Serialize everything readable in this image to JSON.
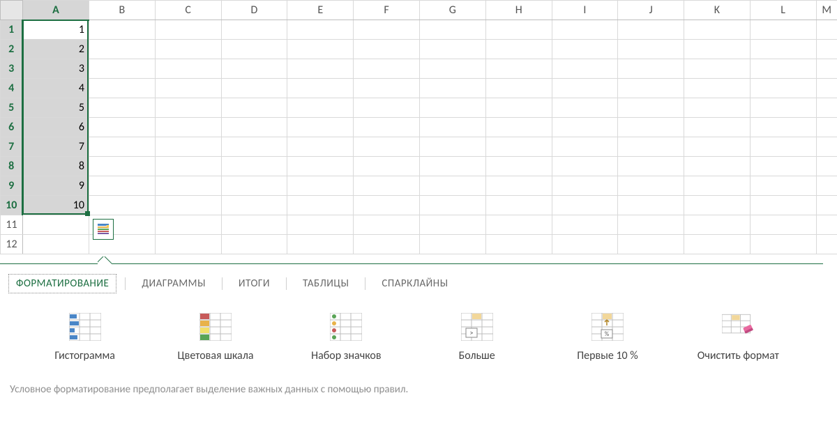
{
  "columns": [
    "A",
    "B",
    "C",
    "D",
    "E",
    "F",
    "G",
    "H",
    "I",
    "J",
    "K",
    "L",
    "M"
  ],
  "rows": [
    1,
    2,
    3,
    4,
    5,
    6,
    7,
    8,
    9,
    10,
    11,
    12
  ],
  "cells": {
    "A": [
      "1",
      "2",
      "3",
      "4",
      "5",
      "6",
      "7",
      "8",
      "9",
      "10",
      "",
      ""
    ]
  },
  "selection": {
    "col": "A",
    "rowStart": 1,
    "rowEnd": 10
  },
  "quick_analysis": {
    "tabs": [
      "ФОРМАТИРОВАНИЕ",
      "ДИАГРАММЫ",
      "ИТОГИ",
      "ТАБЛИЦЫ",
      "СПАРКЛАЙНЫ"
    ],
    "active_tab": 0,
    "options": [
      {
        "label": "Гистограмма",
        "icon": "data-bars-icon"
      },
      {
        "label": "Цветовая шкала",
        "icon": "color-scale-icon"
      },
      {
        "label": "Набор значков",
        "icon": "icon-set-icon"
      },
      {
        "label": "Больше",
        "icon": "greater-than-icon"
      },
      {
        "label": "Первые 10 %",
        "icon": "top-10-percent-icon"
      },
      {
        "label": "Очистить формат",
        "icon": "clear-format-icon"
      }
    ],
    "description": "Условное форматирование предполагает выделение важных данных с помощью правил."
  }
}
